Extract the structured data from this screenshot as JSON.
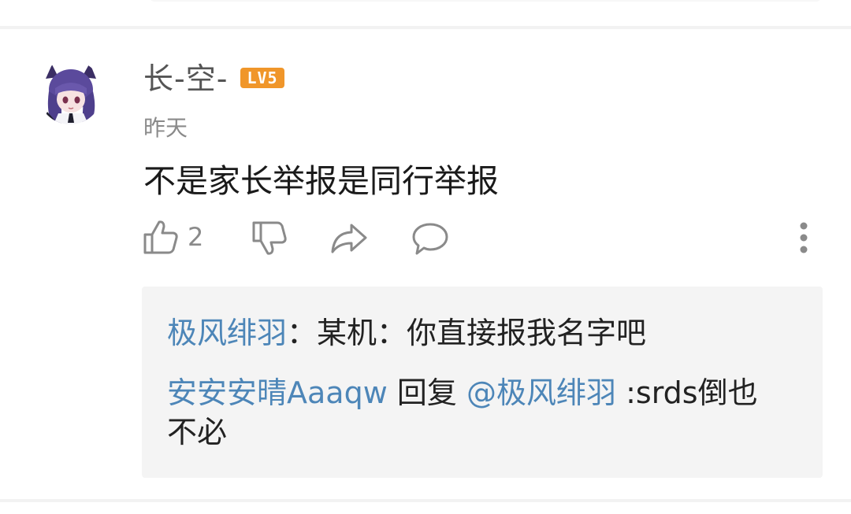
{
  "comment": {
    "username": "长-空-",
    "level_badge": "LV5",
    "timestamp": "昨天",
    "text": "不是家长举报是同行举报",
    "like_count": "2"
  },
  "icons": {
    "like": "thumbs-up-icon",
    "dislike": "thumbs-down-icon",
    "share": "share-arrow-icon",
    "reply": "speech-bubble-icon",
    "more": "more-vertical-icon"
  },
  "replies": [
    {
      "author": "极风绯羽",
      "separator": "：",
      "text": "某机：你直接报我名字吧"
    },
    {
      "author": "安安安晴Aaaqw",
      "reply_word": "回复",
      "mention": "@极风绯羽",
      "text": ":srds倒也不必"
    }
  ],
  "colors": {
    "link": "#4d86b8",
    "badge": "#f0962a",
    "reply_bg": "#f4f4f4"
  }
}
